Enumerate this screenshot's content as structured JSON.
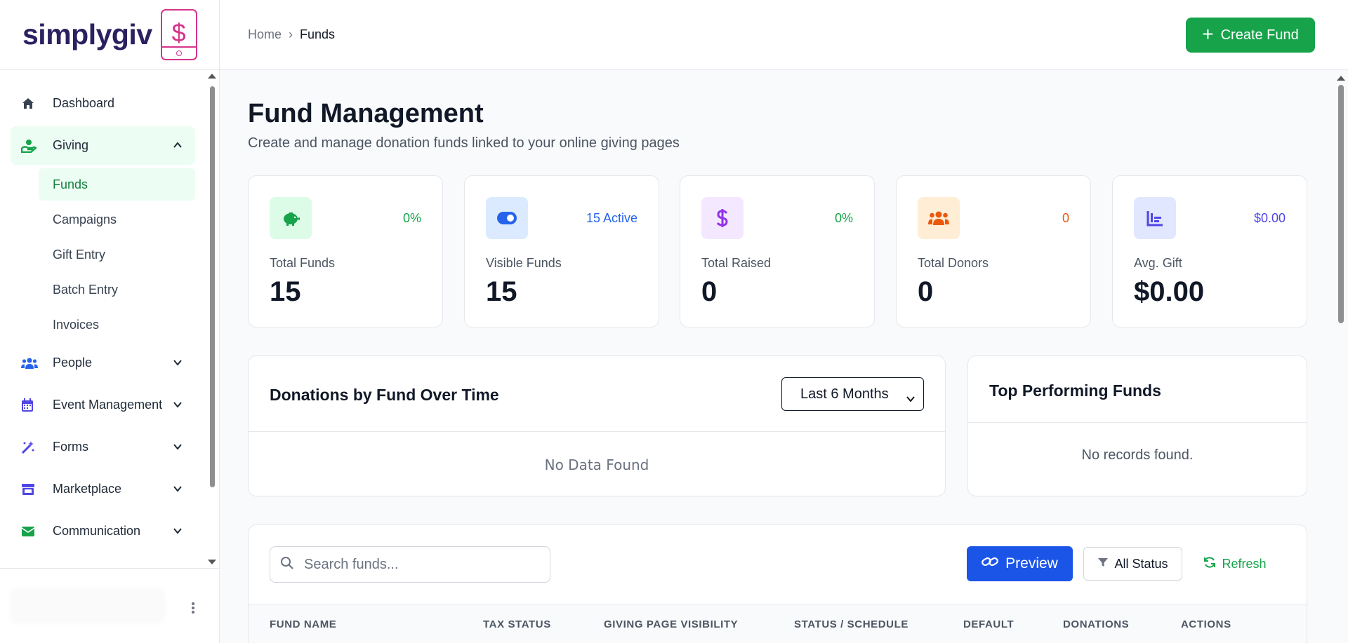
{
  "brand": {
    "name": "simplygiv",
    "phone_glyph": "$"
  },
  "sidebar": {
    "items": [
      {
        "label": "Dashboard",
        "icon": "home-icon"
      },
      {
        "label": "Giving",
        "icon": "hand-giving-icon"
      },
      {
        "label": "People",
        "icon": "users-icon"
      },
      {
        "label": "Event Management",
        "icon": "calendar-icon"
      },
      {
        "label": "Forms",
        "icon": "magic-wand-icon"
      },
      {
        "label": "Marketplace",
        "icon": "store-icon"
      },
      {
        "label": "Communication",
        "icon": "envelope-icon"
      }
    ],
    "giving_sub": [
      "Funds",
      "Campaigns",
      "Gift Entry",
      "Batch Entry",
      "Invoices"
    ],
    "active_sub": "Funds"
  },
  "header": {
    "breadcrumb": {
      "home": "Home",
      "separator": "›",
      "current": "Funds"
    },
    "create_label": "Create Fund",
    "create_plus": "+"
  },
  "page": {
    "title": "Fund Management",
    "subtitle": "Create and manage donation funds linked to your online giving pages"
  },
  "stats": [
    {
      "label": "Total Funds",
      "value": "15",
      "badge": "0%",
      "badge_color": "#16a34a",
      "icon": "piggy-bank-icon",
      "icon_bg": "#dcfce7",
      "icon_color": "#16a34a"
    },
    {
      "label": "Visible Funds",
      "value": "15",
      "badge": "15 Active",
      "badge_color": "#2563eb",
      "icon": "toggle-icon",
      "icon_bg": "#dbeafe",
      "icon_color": "#2563eb"
    },
    {
      "label": "Total Raised",
      "value": "0",
      "badge": "0%",
      "badge_color": "#16a34a",
      "icon": "dollar-icon",
      "icon_bg": "#f3e8ff",
      "icon_color": "#9333ea"
    },
    {
      "label": "Total Donors",
      "value": "0",
      "badge": "0",
      "badge_color": "#ea580c",
      "icon": "users-icon",
      "icon_bg": "#ffedd5",
      "icon_color": "#ea580c"
    },
    {
      "label": "Avg. Gift",
      "value": "$0.00",
      "badge": "$0.00",
      "badge_color": "#4f46e5",
      "icon": "bar-chart-icon",
      "icon_bg": "#e0e7ff",
      "icon_color": "#4f46e5"
    }
  ],
  "donations_chart": {
    "title": "Donations by Fund Over Time",
    "period": "Last 6 Months",
    "empty": "No Data Found"
  },
  "top_funds": {
    "title": "Top Performing Funds",
    "empty": "No records found."
  },
  "table": {
    "search_placeholder": "Search funds...",
    "preview_label": "Preview",
    "status_label": "All Status",
    "refresh_label": "Refresh",
    "columns": [
      "FUND NAME",
      "TAX STATUS",
      "GIVING PAGE VISIBILITY",
      "STATUS / SCHEDULE",
      "DEFAULT",
      "DONATIONS",
      "ACTIONS"
    ]
  },
  "colors": {
    "accent": "#16a34a",
    "primary": "#1b55e8",
    "brand": "#2b2160",
    "brand_pink": "#d6338a"
  }
}
